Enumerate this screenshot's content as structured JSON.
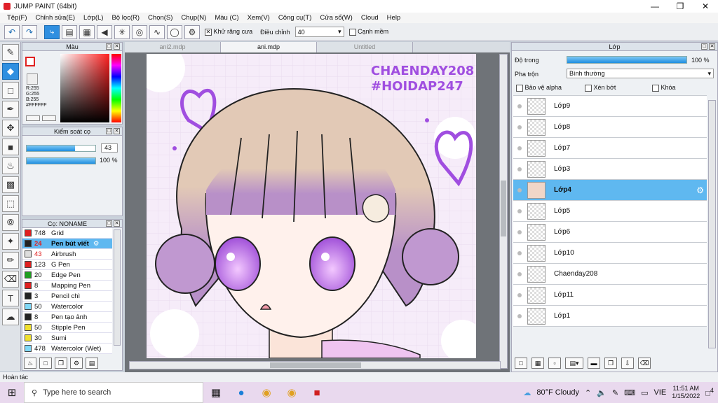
{
  "window": {
    "title": "JUMP PAINT (64bit)"
  },
  "menu": [
    "Tệp(F)",
    "Chỉnh sửa(E)",
    "Lớp(L)",
    "Bộ lọc(R)",
    "Chọn(S)",
    "Chụp(N)",
    "Màu (C)",
    "Xem(V)",
    "Công cụ(T)",
    "Cửa sổ(W)",
    "Cloud",
    "Help"
  ],
  "toolbar": {
    "antialias_label": "Khử răng cưa",
    "adjust_label": "Điều chỉnh",
    "adjust_value": "40",
    "snap_label": "Cạnh mềm"
  },
  "color_panel": {
    "title": "Màu",
    "r": "R:255",
    "g": "G:255",
    "b": "B:255",
    "hex": "#FFFFFF"
  },
  "brush_control": {
    "title": "Kiểm soát cọ",
    "size_value": "43",
    "size_fraction": 0.7,
    "opacity_value": "100 %",
    "opacity_fraction": 1.0
  },
  "brush_list": {
    "title": "Cọ: NONAME",
    "items": [
      {
        "size": "748",
        "name": "Grid",
        "color": "#e02020"
      },
      {
        "size": "24",
        "name": "Pen bút viết",
        "color": "#222222",
        "selected": true
      },
      {
        "size": "43",
        "name": "Airbrush",
        "color": "#dddddd"
      },
      {
        "size": "123",
        "name": "G Pen",
        "color": "#e02020"
      },
      {
        "size": "20",
        "name": "Edge Pen",
        "color": "#20a020"
      },
      {
        "size": "8",
        "name": "Mapping Pen",
        "color": "#e02020"
      },
      {
        "size": "3",
        "name": "Pencil chì",
        "color": "#222222"
      },
      {
        "size": "50",
        "name": "Watercolor",
        "color": "#80d8f8"
      },
      {
        "size": "8",
        "name": "Pen tạo ảnh",
        "color": "#222222"
      },
      {
        "size": "50",
        "name": "Stipple Pen",
        "color": "#f0e030"
      },
      {
        "size": "30",
        "name": "Sumi",
        "color": "#f0e030"
      },
      {
        "size": "478",
        "name": "Watercolor (Wet)",
        "color": "#80d8f8"
      }
    ]
  },
  "tabs": [
    "ani2.mdp",
    "ani.mdp",
    "Untitled"
  ],
  "canvas": {
    "watermark1": "CHAENDAY208",
    "watermark2": "#HOIDAP247"
  },
  "layer_panel": {
    "title": "Lớp",
    "opacity_label": "Độ trong",
    "opacity_value": "100 %",
    "blend_label": "Pha trộn",
    "blend_value": "Bình thường",
    "protect_alpha": "Bảo vệ alpha",
    "clipping": "Xén bớt",
    "lock": "Khóa",
    "layers": [
      {
        "name": "Lớp9"
      },
      {
        "name": "Lớp8"
      },
      {
        "name": "Lớp7"
      },
      {
        "name": "Lớp3"
      },
      {
        "name": "Lớp4",
        "selected": true
      },
      {
        "name": "Lớp5"
      },
      {
        "name": "Lớp6"
      },
      {
        "name": "Lớp10"
      },
      {
        "name": "Chaenday208"
      },
      {
        "name": "Lớp11"
      },
      {
        "name": "Lớp1"
      }
    ]
  },
  "status": {
    "text": "Hoàn tác"
  },
  "taskbar": {
    "search_placeholder": "Type here to search",
    "weather": "80°F  Cloudy",
    "lang": "VIE",
    "time": "11:51 AM",
    "date": "1/15/2022",
    "notifications": "4"
  }
}
